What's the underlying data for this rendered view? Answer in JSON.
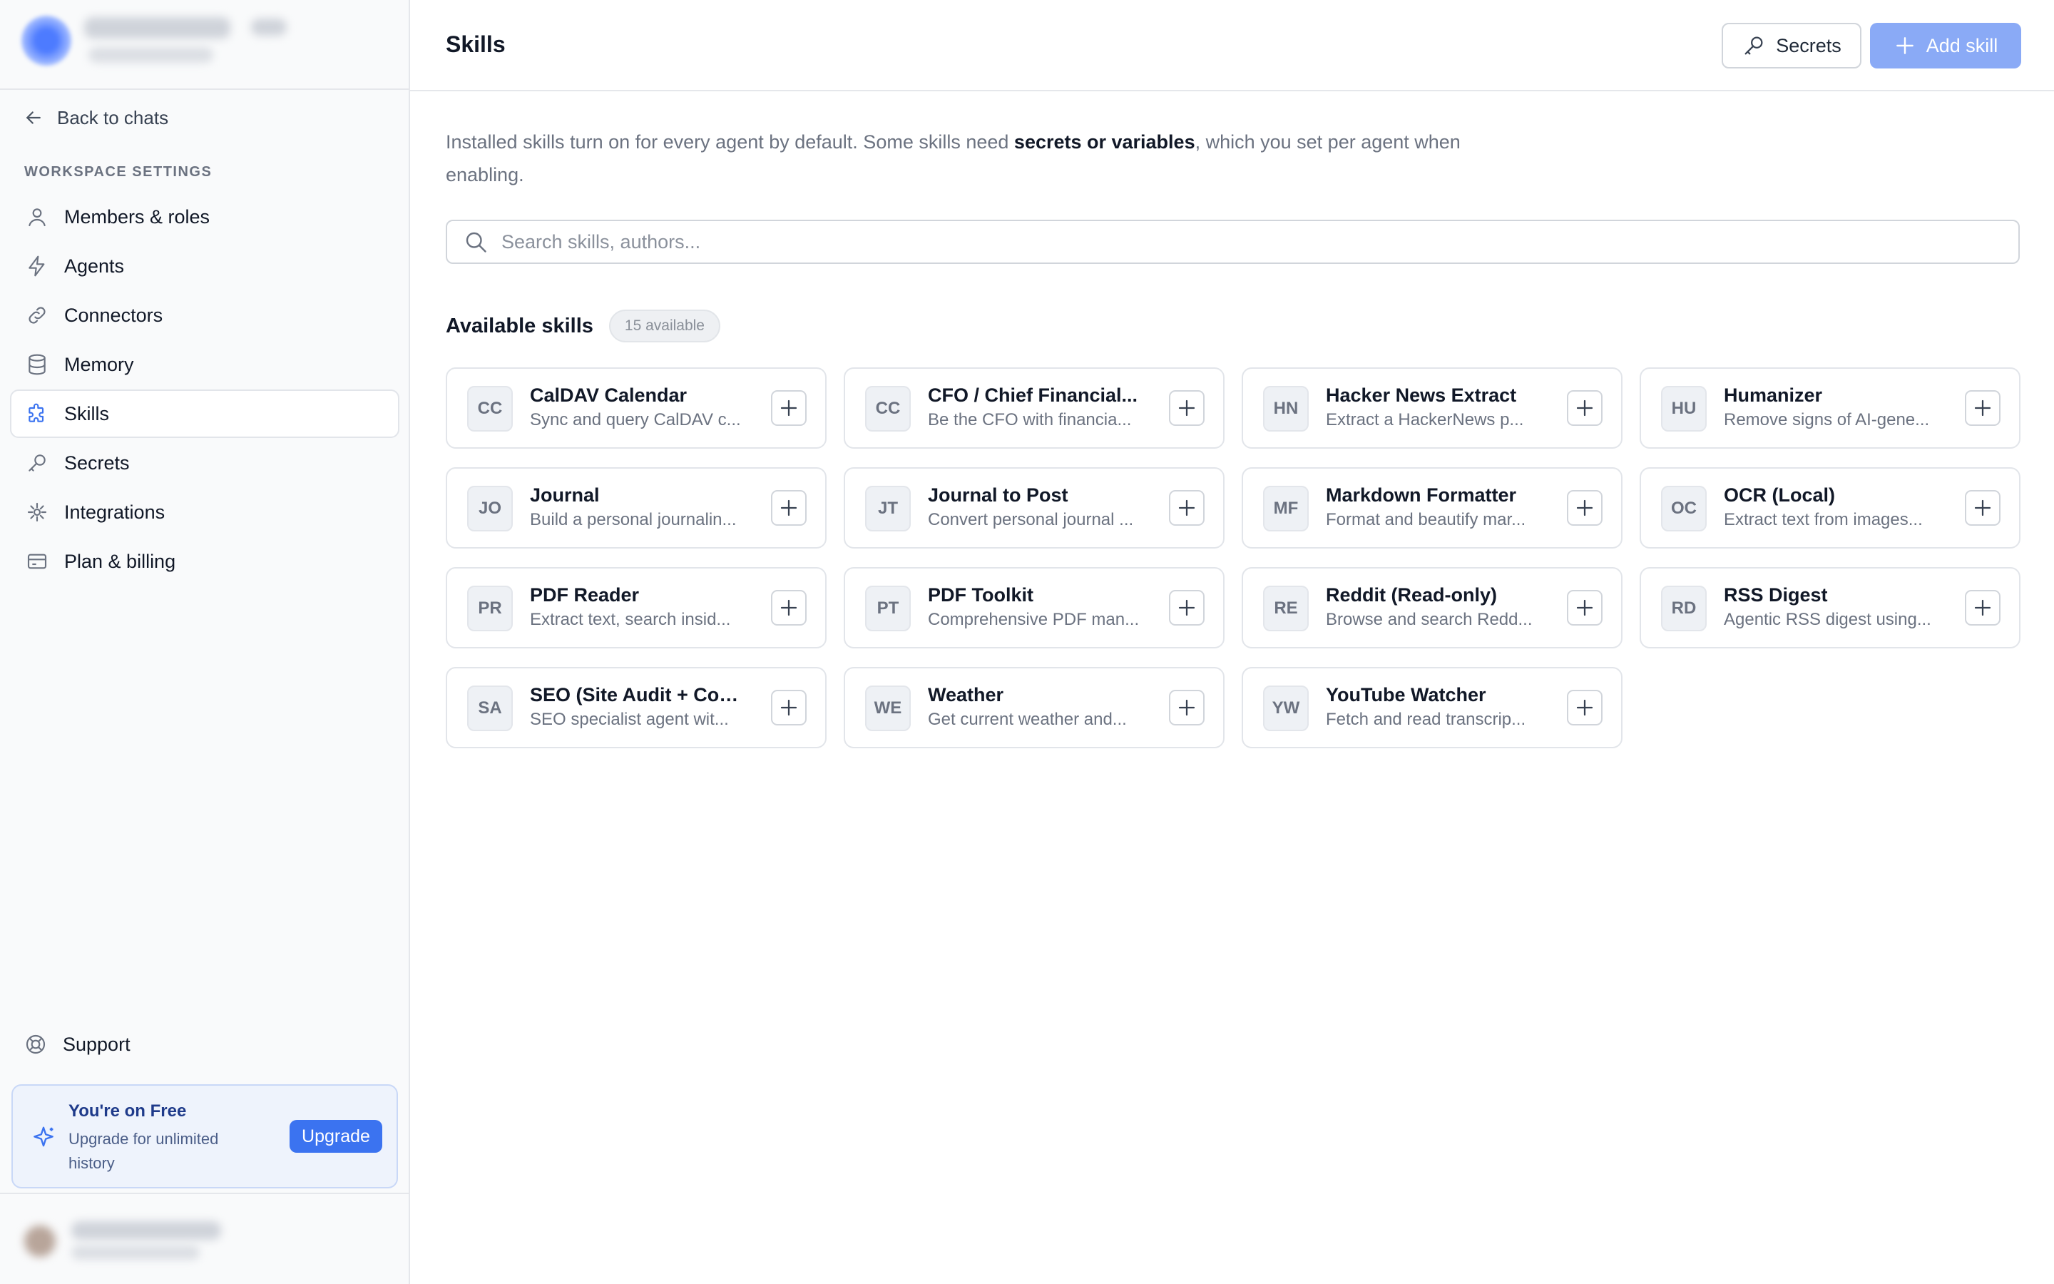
{
  "app": {
    "page_title": "Skills"
  },
  "header": {
    "secrets_label": "Secrets",
    "add_skill_label": "Add skill"
  },
  "sidebar": {
    "back_label": "Back to chats",
    "section_label": "WORKSPACE SETTINGS",
    "items": [
      {
        "label": "Members & roles",
        "icon": "user-icon"
      },
      {
        "label": "Agents",
        "icon": "bolt-icon"
      },
      {
        "label": "Connectors",
        "icon": "link-icon"
      },
      {
        "label": "Memory",
        "icon": "database-icon"
      },
      {
        "label": "Skills",
        "icon": "puzzle-icon",
        "active": true
      },
      {
        "label": "Secrets",
        "icon": "key-icon"
      },
      {
        "label": "Integrations",
        "icon": "plug-icon"
      },
      {
        "label": "Plan & billing",
        "icon": "credit-card-icon"
      }
    ],
    "support_label": "Support",
    "upgrade": {
      "title": "You're on Free",
      "subtitle": "Upgrade for unlimited history",
      "button": "Upgrade"
    }
  },
  "intro": {
    "before": "Installed skills turn on for every agent by default. Some skills need ",
    "emphasis": "secrets or variables",
    "after": ", which you set per agent when enabling."
  },
  "search": {
    "placeholder": "Search skills, authors..."
  },
  "available": {
    "title": "Available skills",
    "badge": "15 available"
  },
  "skills": [
    {
      "initials": "CC",
      "name": "CalDAV Calendar",
      "desc": "Sync and query CalDAV c..."
    },
    {
      "initials": "CC",
      "name": "CFO / Chief Financial...",
      "desc": "Be the CFO with financia..."
    },
    {
      "initials": "HN",
      "name": "Hacker News Extract",
      "desc": "Extract a HackerNews p..."
    },
    {
      "initials": "HU",
      "name": "Humanizer",
      "desc": "Remove signs of AI-gene..."
    },
    {
      "initials": "JO",
      "name": "Journal",
      "desc": "Build a personal journalin..."
    },
    {
      "initials": "JT",
      "name": "Journal to Post",
      "desc": "Convert personal journal ..."
    },
    {
      "initials": "MF",
      "name": "Markdown Formatter",
      "desc": "Format and beautify mar..."
    },
    {
      "initials": "OC",
      "name": "OCR (Local)",
      "desc": "Extract text from images..."
    },
    {
      "initials": "PR",
      "name": "PDF Reader",
      "desc": "Extract text, search insid..."
    },
    {
      "initials": "PT",
      "name": "PDF Toolkit",
      "desc": "Comprehensive PDF man..."
    },
    {
      "initials": "RE",
      "name": "Reddit (Read-only)",
      "desc": "Browse and search Redd..."
    },
    {
      "initials": "RD",
      "name": "RSS Digest",
      "desc": "Agentic RSS digest using..."
    },
    {
      "initials": "SA",
      "name": "SEO (Site Audit + Con...",
      "desc": "SEO specialist agent wit..."
    },
    {
      "initials": "WE",
      "name": "Weather",
      "desc": "Get current weather and..."
    },
    {
      "initials": "YW",
      "name": "YouTube Watcher",
      "desc": "Fetch and read transcrip..."
    }
  ],
  "colors": {
    "accent": "#3b73f0",
    "accent_light": "#8aaaf6",
    "sidebar_bg": "#f9fafb",
    "border": "#e5e7eb"
  }
}
